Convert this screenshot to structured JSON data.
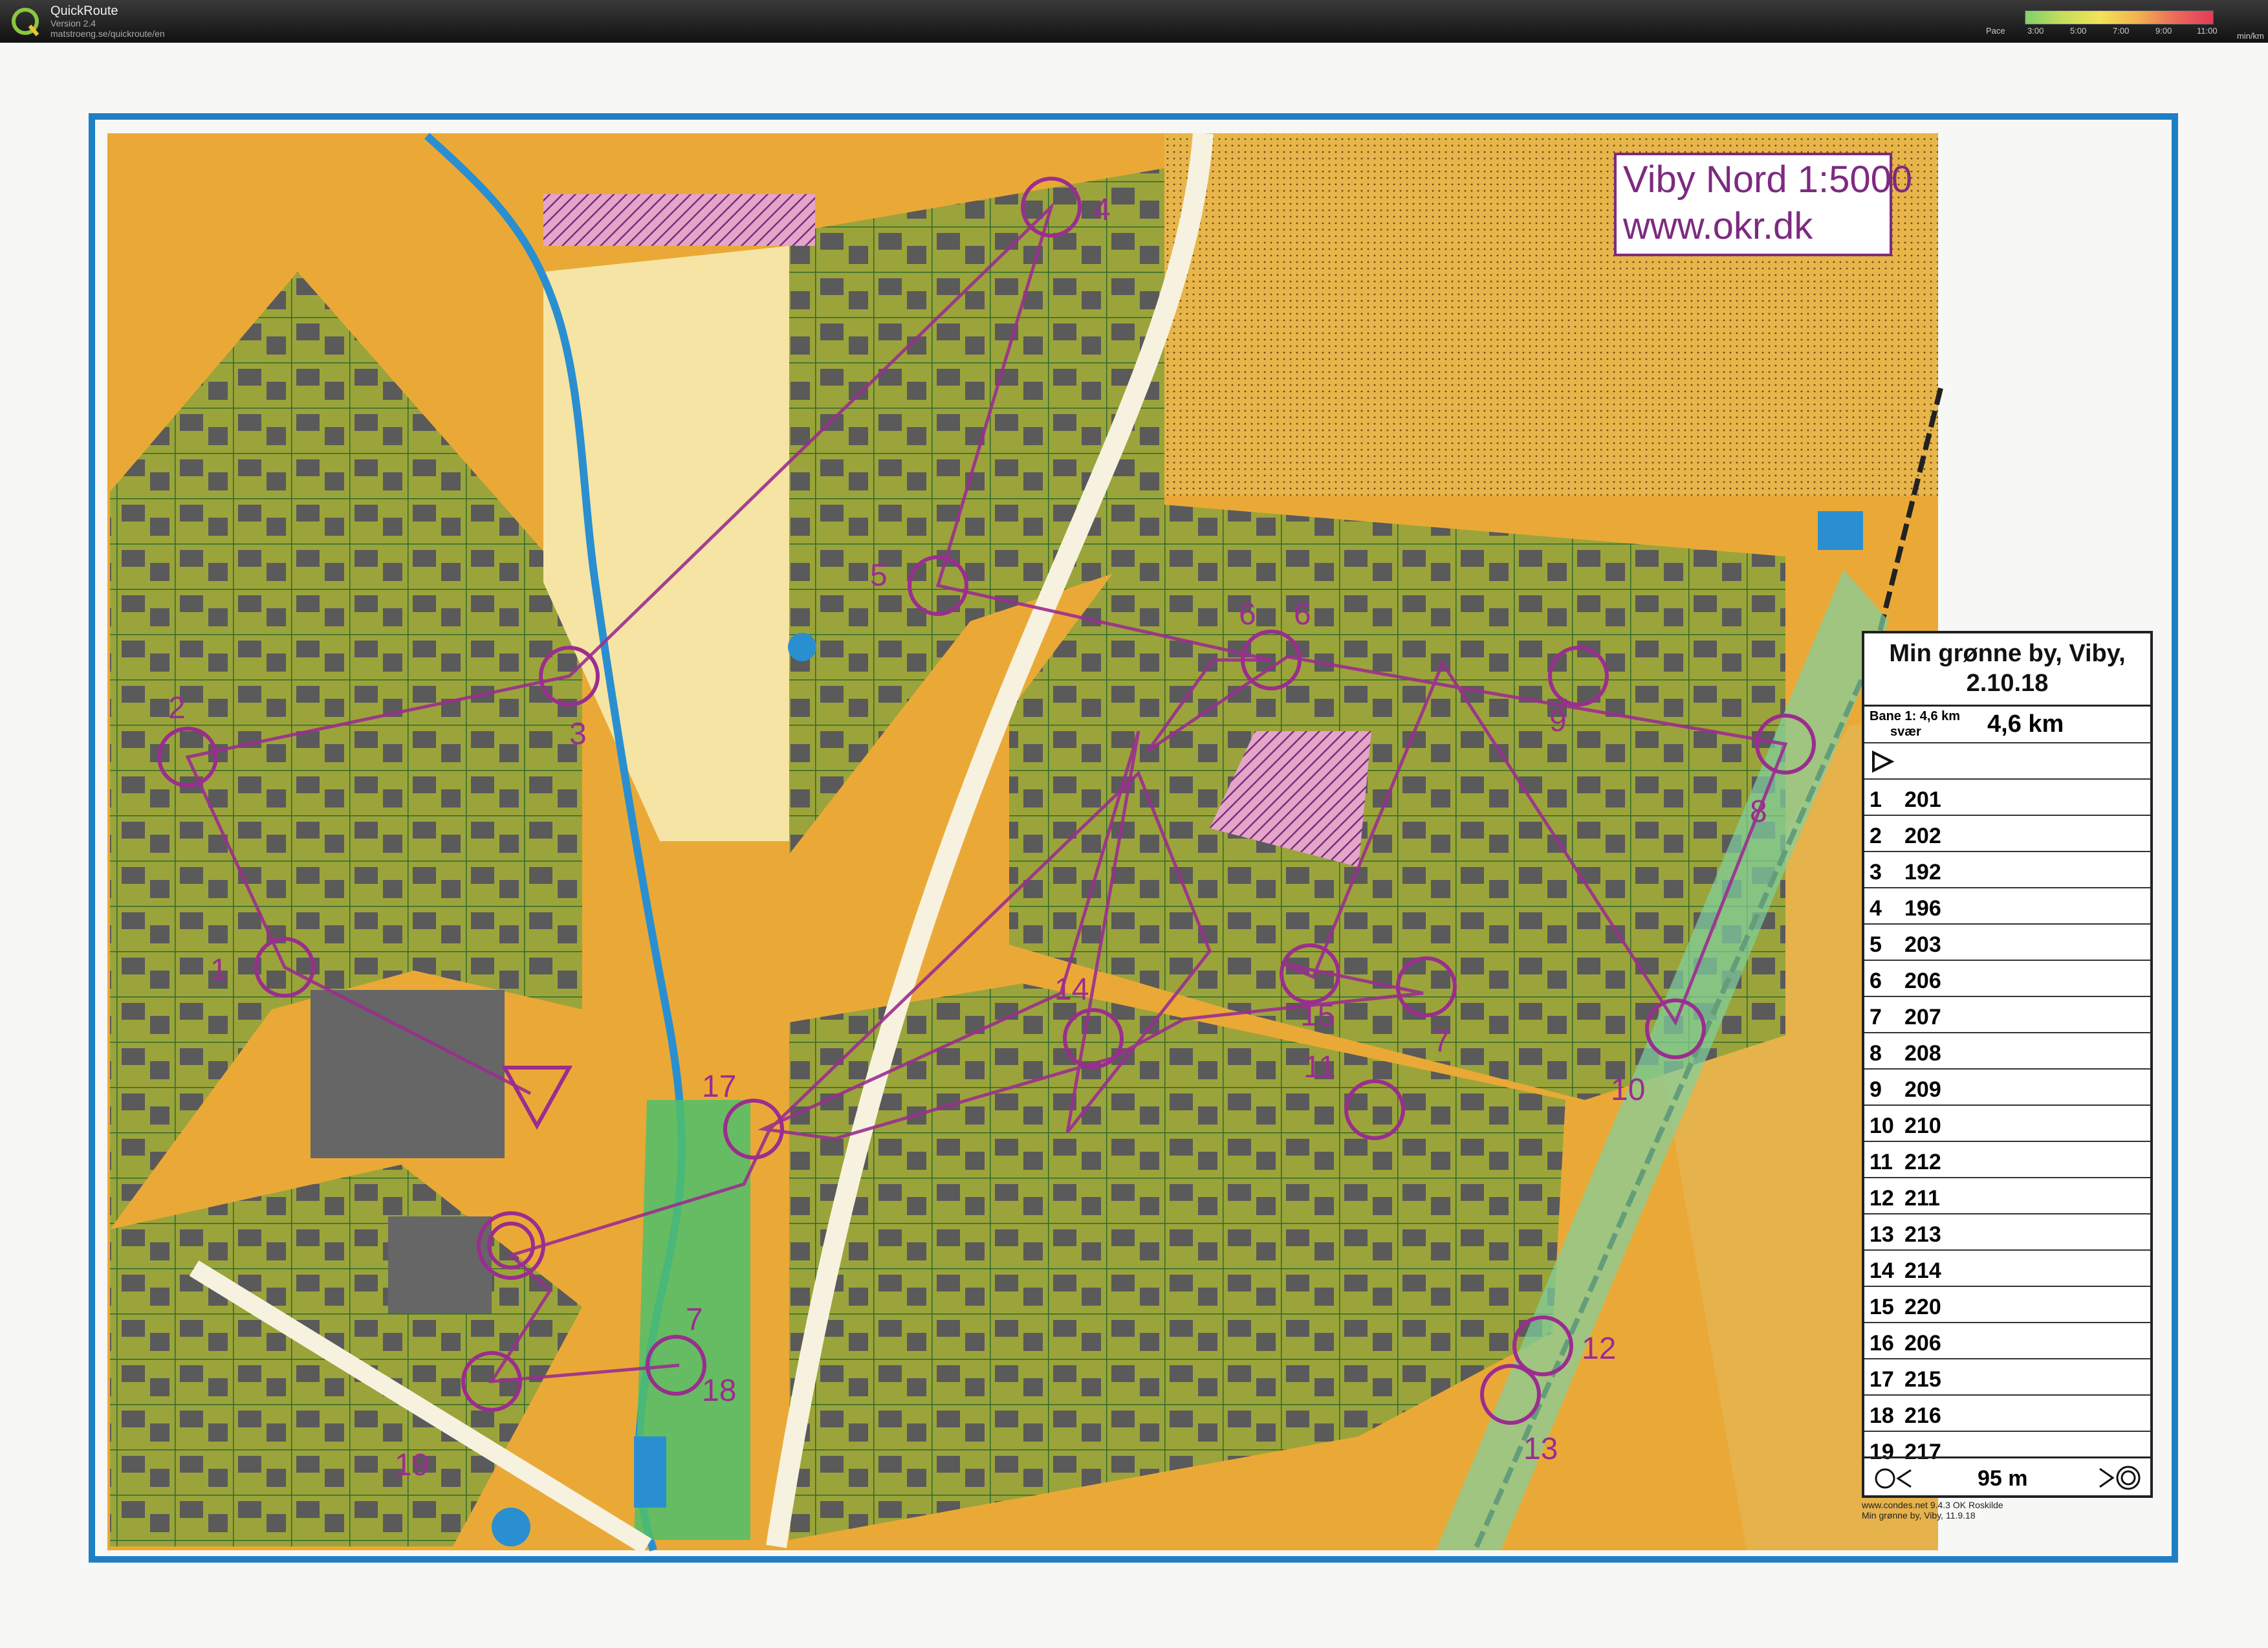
{
  "app": {
    "name": "QuickRoute",
    "version": "Version 2.4",
    "url": "matstroeng.se/quickroute/en",
    "pace_label": "Pace",
    "pace_ticks": [
      "3:00",
      "5:00",
      "7:00",
      "9:00",
      "11:00"
    ],
    "pace_unit": "min/km"
  },
  "map": {
    "title": "Viby Nord 1:5000",
    "website": "www.okr.dk",
    "course_color": "#9b2d8f",
    "route_color": "#9b2d8f"
  },
  "controls": [
    {
      "label": "1"
    },
    {
      "label": "2"
    },
    {
      "label": "3"
    },
    {
      "label": "4"
    },
    {
      "label": "5"
    },
    {
      "label": "6"
    },
    {
      "label": "6"
    },
    {
      "label": "7"
    },
    {
      "label": "8"
    },
    {
      "label": "9"
    },
    {
      "label": "10"
    },
    {
      "label": "11"
    },
    {
      "label": "12"
    },
    {
      "label": "13"
    },
    {
      "label": "14"
    },
    {
      "label": "15"
    },
    {
      "label": "17"
    },
    {
      "label": "7"
    },
    {
      "label": "18"
    },
    {
      "label": "19"
    }
  ],
  "description_sheet": {
    "event": "Min grønne by, Viby,",
    "date": "2.10.18",
    "course": "Bane 1: 4,6 km",
    "difficulty": "svær",
    "length": "4,6 km",
    "rows": [
      {
        "num": "1",
        "code": "201"
      },
      {
        "num": "2",
        "code": "202"
      },
      {
        "num": "3",
        "code": "192"
      },
      {
        "num": "4",
        "code": "196"
      },
      {
        "num": "5",
        "code": "203"
      },
      {
        "num": "6",
        "code": "206"
      },
      {
        "num": "7",
        "code": "207"
      },
      {
        "num": "8",
        "code": "208"
      },
      {
        "num": "9",
        "code": "209"
      },
      {
        "num": "10",
        "code": "210"
      },
      {
        "num": "11",
        "code": "212"
      },
      {
        "num": "12",
        "code": "211"
      },
      {
        "num": "13",
        "code": "213"
      },
      {
        "num": "14",
        "code": "214"
      },
      {
        "num": "15",
        "code": "220"
      },
      {
        "num": "16",
        "code": "206"
      },
      {
        "num": "17",
        "code": "215"
      },
      {
        "num": "18",
        "code": "216"
      },
      {
        "num": "19",
        "code": "217"
      }
    ],
    "finish_distance": "95 m",
    "footer_line1": "www.condes.net 9.4.3 OK Roskilde",
    "footer_line2": "Min grønne by, Viby, 11.9.18"
  }
}
